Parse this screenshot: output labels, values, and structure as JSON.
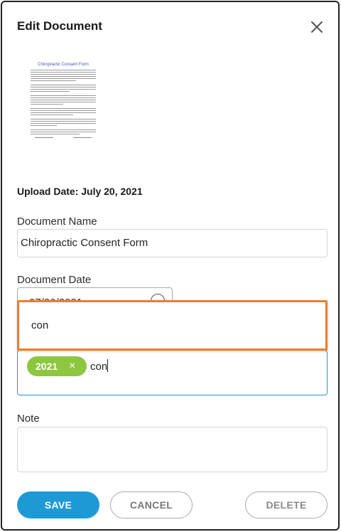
{
  "dialog": {
    "title": "Edit Document",
    "close_icon": "close-icon"
  },
  "thumbnail": {
    "title": "Chiropractic Consent Form"
  },
  "upload_date": "Upload Date: July 20, 2021",
  "document_name": {
    "label": "Document Name",
    "value": "Chiropractic Consent Form"
  },
  "document_date": {
    "label": "Document Date",
    "value": "07/20/2021",
    "icon": "calendar-icon"
  },
  "tags": {
    "chip": "2021",
    "chip_remove": "×",
    "input_text": "con"
  },
  "suggestions": {
    "items": [
      "con"
    ]
  },
  "note": {
    "label": "Note",
    "value": ""
  },
  "buttons": {
    "save": "SAVE",
    "cancel": "CANCEL",
    "delete": "DELETE"
  },
  "colors": {
    "save": "#1d9ad6",
    "tag_chip": "#8dc63f",
    "focus_border": "#2a92c9",
    "highlight": "#f07c2a"
  }
}
